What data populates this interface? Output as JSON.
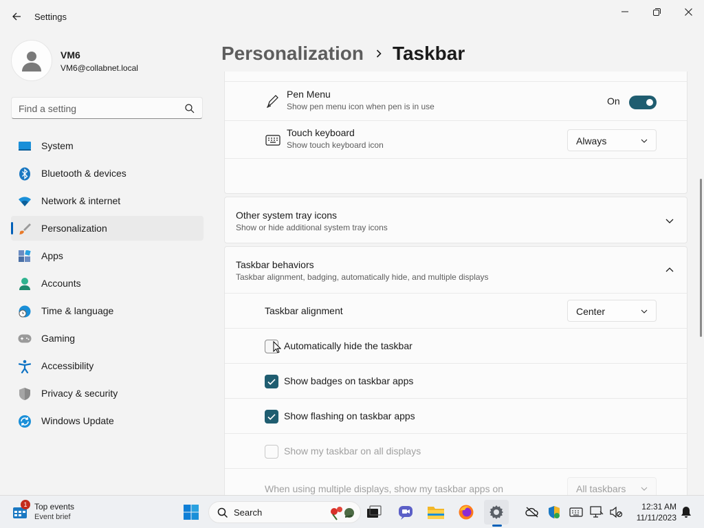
{
  "window": {
    "title": "Settings"
  },
  "profile": {
    "name": "VM6",
    "email": "VM6@collabnet.local"
  },
  "search": {
    "placeholder": "Find a setting"
  },
  "sidebar": {
    "items": [
      {
        "label": "System",
        "icon": "system-icon"
      },
      {
        "label": "Bluetooth & devices",
        "icon": "bluetooth-icon"
      },
      {
        "label": "Network & internet",
        "icon": "wifi-icon"
      },
      {
        "label": "Personalization",
        "icon": "paintbrush-icon",
        "selected": true
      },
      {
        "label": "Apps",
        "icon": "apps-icon"
      },
      {
        "label": "Accounts",
        "icon": "accounts-icon"
      },
      {
        "label": "Time & language",
        "icon": "clock-globe-icon"
      },
      {
        "label": "Gaming",
        "icon": "gamepad-icon"
      },
      {
        "label": "Accessibility",
        "icon": "accessibility-icon"
      },
      {
        "label": "Privacy & security",
        "icon": "shield-icon"
      },
      {
        "label": "Windows Update",
        "icon": "update-icon"
      }
    ]
  },
  "header": {
    "parent": "Personalization",
    "separator": ">",
    "current": "Taskbar"
  },
  "corner_icons": {
    "pen_menu": {
      "title": "Pen Menu",
      "description": "Show pen menu icon when pen is in use",
      "toggle_label": "On",
      "toggle_on": true
    },
    "touch_keyboard": {
      "title": "Touch keyboard",
      "description": "Show touch keyboard icon",
      "value": "Always"
    }
  },
  "other_tray": {
    "title": "Other system tray icons",
    "description": "Show or hide additional system tray icons",
    "expanded": false
  },
  "behaviors": {
    "title": "Taskbar behaviors",
    "description": "Taskbar alignment, badging, automatically hide, and multiple displays",
    "expanded": true,
    "alignment": {
      "label": "Taskbar alignment",
      "value": "Center"
    },
    "options": [
      {
        "label": "Automatically hide the taskbar",
        "checked": false,
        "disabled": false
      },
      {
        "label": "Show badges on taskbar apps",
        "checked": true,
        "disabled": false
      },
      {
        "label": "Show flashing on taskbar apps",
        "checked": true,
        "disabled": false
      },
      {
        "label": "Show my taskbar on all displays",
        "checked": false,
        "disabled": true
      }
    ],
    "multi_display": {
      "label": "When using multiple displays, show my taskbar apps on",
      "value": "All taskbars",
      "disabled": true
    }
  },
  "taskbar": {
    "widget": {
      "title": "Top events",
      "subtitle": "Event brief",
      "badge": "1"
    },
    "search_label": "Search",
    "clock": {
      "time": "12:31 AM",
      "date": "11/11/2023"
    }
  },
  "colors": {
    "accent": "#1f5d70",
    "selection_bar": "#005fb8"
  }
}
